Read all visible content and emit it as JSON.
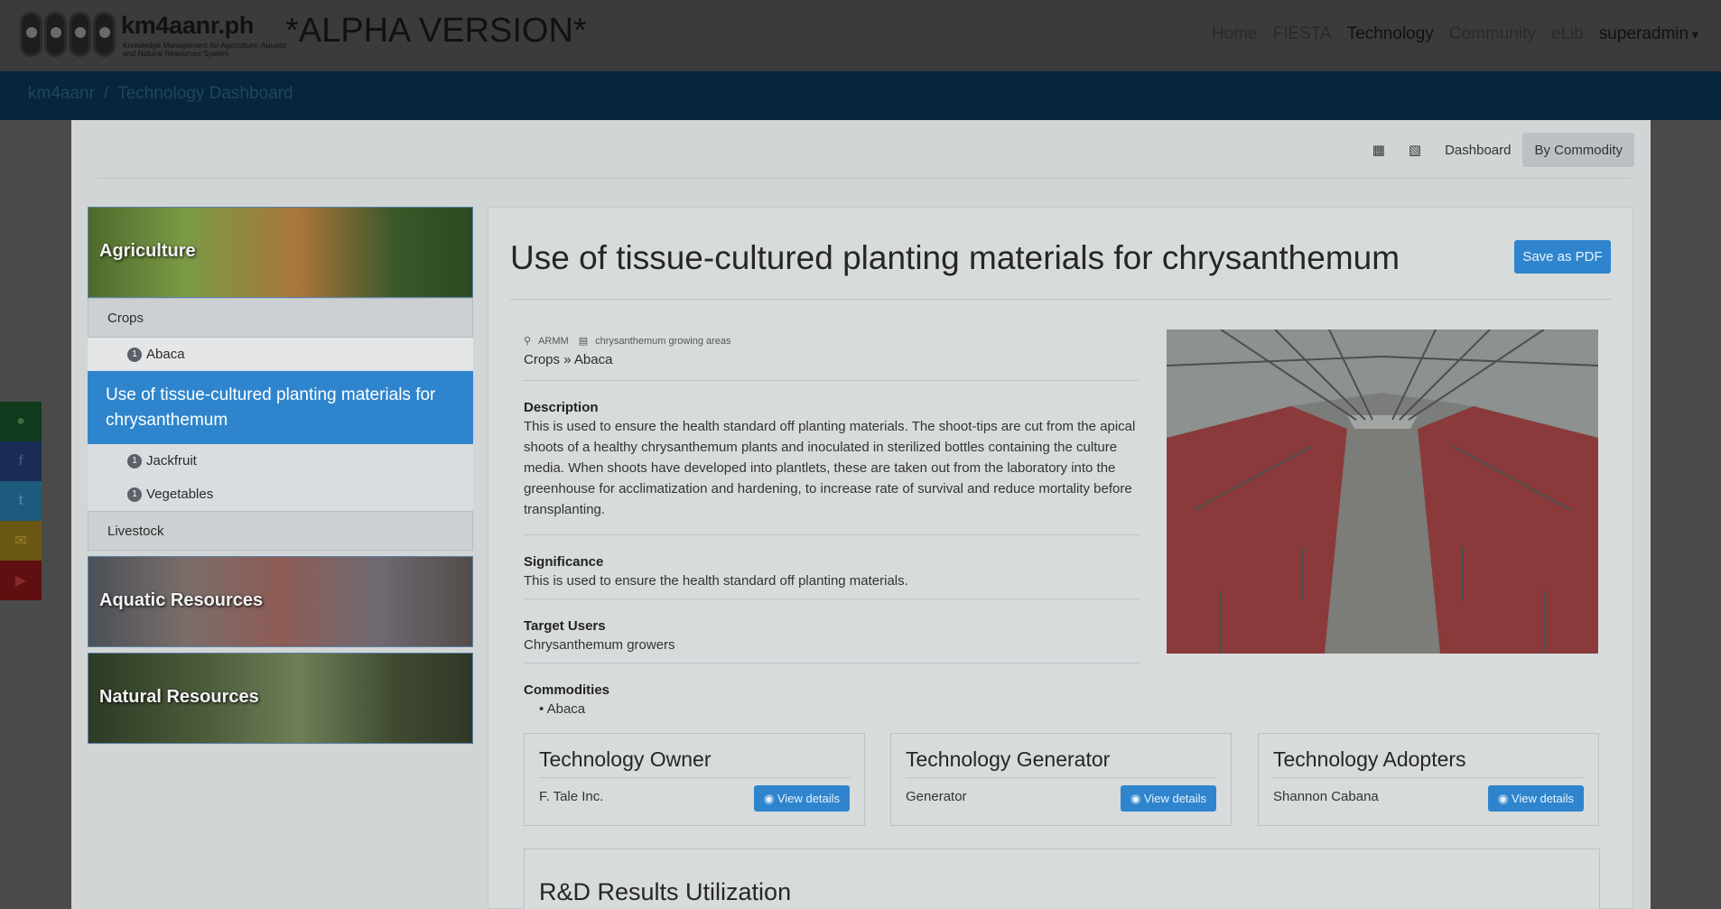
{
  "brand": {
    "title": "km4aanr.ph",
    "subtitle": "Knowledge Management for Agriculture, Aquatic and Natural Resources System",
    "alpha": "*ALPHA VERSION*"
  },
  "nav": {
    "items": [
      "Home",
      "FIESTA",
      "Technology",
      "Community",
      "eLib"
    ],
    "user": "superadmin"
  },
  "breadcrumb": {
    "home": "km4aanr",
    "separator": "/",
    "current": "Technology Dashboard"
  },
  "viewbar": {
    "dashboard": "Dashboard",
    "by_commodity": "By Commodity"
  },
  "sidebar": {
    "agriculture": "Agriculture",
    "crops": "Crops",
    "abaca": {
      "count": "1",
      "label": "Abaca"
    },
    "selected": "Use of tissue-cultured planting materials for chrysanthemum",
    "jackfruit": {
      "count": "1",
      "label": "Jackfruit"
    },
    "vegetables": {
      "count": "1",
      "label": "Vegetables"
    },
    "livestock": "Livestock",
    "aquatic": "Aquatic Resources",
    "natural": "Natural Resources"
  },
  "social": [
    {
      "icon": "logo-icon",
      "color": "#0f3a1c"
    },
    {
      "icon": "facebook-icon",
      "color": "#1a2c56"
    },
    {
      "icon": "twitter-icon",
      "color": "#1d5a7d"
    },
    {
      "icon": "email-icon",
      "color": "#6a5713"
    },
    {
      "icon": "youtube-icon",
      "color": "#5f0f0f"
    }
  ],
  "tech": {
    "title": "Use of tissue-cultured planting materials for chrysanthemum",
    "save_pdf": "Save as PDF",
    "region": "ARMM",
    "area": "chrysanthemum growing areas",
    "path_cat": "Crops",
    "path_sub": "Abaca",
    "description_label": "Description",
    "description": "This is used to ensure the health standard off planting materials. The shoot-tips are cut from the apical shoots of a healthy chrysanthemum plants and inoculated in sterilized bottles containing the culture media. When shoots have developed into plantlets, these are taken out from the laboratory into the greenhouse for acclimatization and hardening, to increase rate of survival and reduce mortality before transplanting.",
    "significance_label": "Significance",
    "significance": "This is used to ensure the health standard off planting materials.",
    "target_label": "Target Users",
    "target": "Chrysanthemum growers",
    "commodities_label": "Commodities",
    "commodity": "Abaca"
  },
  "boxes": {
    "owner": {
      "title": "Technology Owner",
      "value": "F. Tale Inc.",
      "button": "View details"
    },
    "generator": {
      "title": "Technology Generator",
      "value": "Generator",
      "button": "View details"
    },
    "adopters": {
      "title": "Technology Adopters",
      "value": "Shannon Cabana",
      "button": "View details"
    }
  },
  "rd": {
    "title": "R&D Results Utilization"
  },
  "colors": {
    "accent": "#2f85cd",
    "navbar": "#3b3b3b",
    "breadcrumb_bar": "#07263b"
  }
}
